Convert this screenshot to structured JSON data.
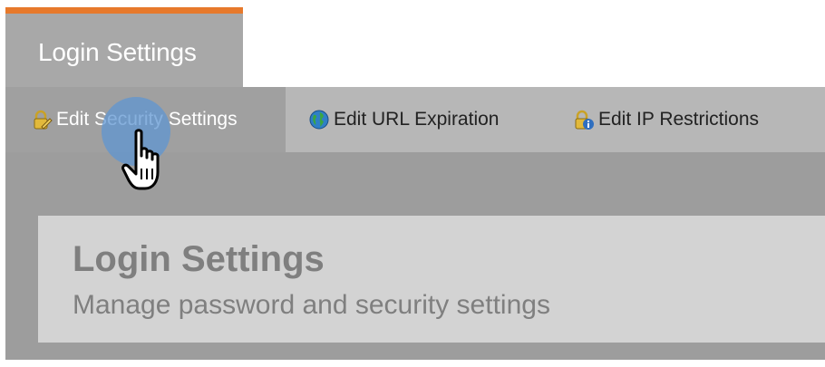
{
  "header": {
    "active_tab_label": "Login Settings",
    "accent_color": "#e7792b"
  },
  "subtabs": [
    {
      "label": "Edit Security Settings",
      "icon": "padlock-pencil-icon",
      "active": true
    },
    {
      "label": "Edit URL Expiration",
      "icon": "globe-icon",
      "active": false
    },
    {
      "label": "Edit IP Restrictions",
      "icon": "padlock-info-icon",
      "active": false
    }
  ],
  "panel": {
    "title": "Login Settings",
    "subtitle": "Manage password and security settings"
  },
  "cursor": {
    "icon": "hand-pointer-icon"
  }
}
